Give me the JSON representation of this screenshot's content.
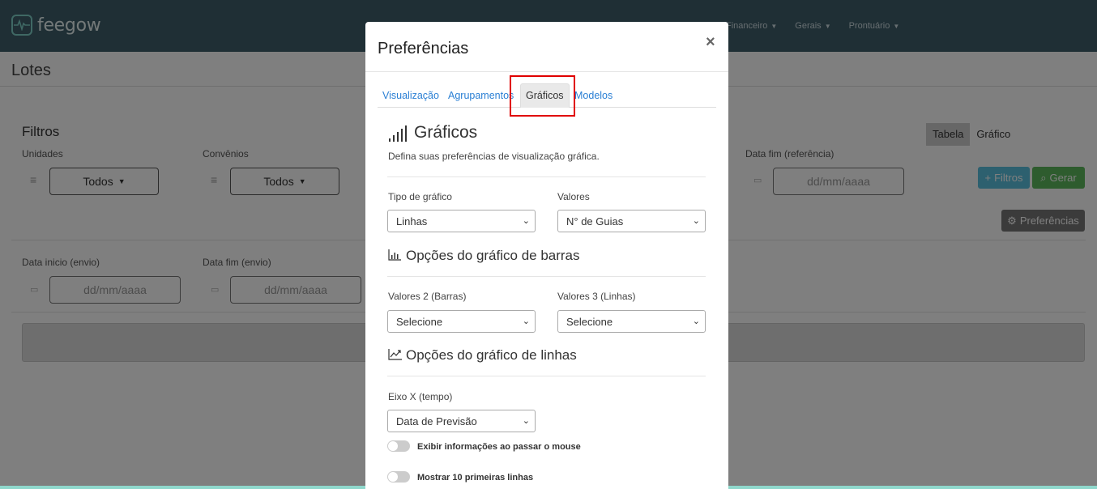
{
  "app": {
    "name": "feegow"
  },
  "nav": {
    "items": [
      "Financeiro",
      "Gerais",
      "Prontuário"
    ]
  },
  "page": {
    "title": "Lotes"
  },
  "filters": {
    "heading": "Filtros",
    "unidades_label": "Unidades",
    "unidades_value": "Todos",
    "convenios_label": "Convênios",
    "convenios_value": "Todos",
    "data_fim_ref_label": "Data fim (referência)",
    "data_fim_ref_placeholder": "dd/mm/aaaa",
    "data_inicio_envio_label": "Data inicio (envio)",
    "data_inicio_envio_placeholder": "dd/mm/aaaa",
    "data_fim_envio_label": "Data fim (envio)",
    "data_fim_envio_placeholder": "dd/mm/aaaa",
    "view_table": "Tabela",
    "view_chart": "Gráfico",
    "btn_filtros": "Filtros",
    "btn_gerar": "Gerar",
    "btn_preferencias": "Preferências"
  },
  "modal": {
    "title": "Preferências",
    "close": "×",
    "tabs": [
      "Visualização",
      "Agrupamentos",
      "Gráficos",
      "Modelos"
    ],
    "active_tab": "Gráficos",
    "section_title": "Gráficos",
    "section_desc": "Defina suas preferências de visualização gráfica.",
    "tipo_label": "Tipo de gráfico",
    "tipo_value": "Linhas",
    "valores_label": "Valores",
    "valores_value": "N° de Guias",
    "barras_title": "Opções do gráfico de barras",
    "valores2_label": "Valores 2 (Barras)",
    "valores2_value": "Selecione",
    "valores3_label": "Valores 3 (Linhas)",
    "valores3_value": "Selecione",
    "linhas_title": "Opções do gráfico de linhas",
    "eixo_label": "Eixo X (tempo)",
    "eixo_value": "Data de Previsão",
    "toggle1_label": "Exibir informações ao passar o mouse",
    "toggle2_label": "Mostrar 10 primeiras linhas"
  },
  "colors": {
    "navbar": "#3e5f6b",
    "link": "#2a7fd4",
    "btn_info": "#5bc0de",
    "btn_success": "#5cb85c",
    "btn_default": "#777777",
    "highlight": "#e00000"
  }
}
